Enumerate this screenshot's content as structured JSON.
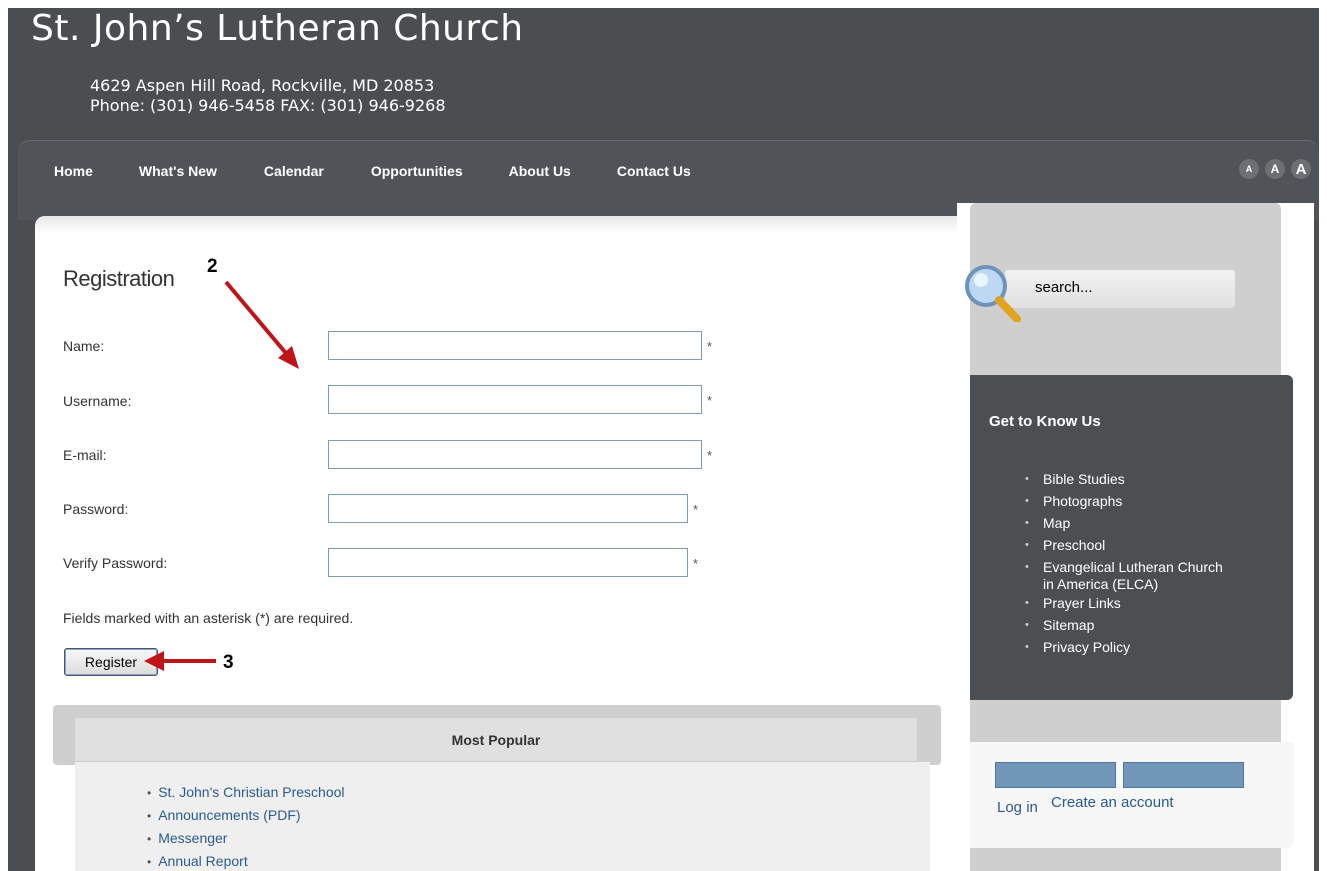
{
  "site": {
    "title": "St. John’s Lutheran Church",
    "address": "4629 Aspen Hill Road, Rockville, MD 20853",
    "phone": "Phone: (301) 946-5458 FAX: (301) 946-9268"
  },
  "nav": {
    "items": [
      "Home",
      "What's New",
      "Calendar",
      "Opportunities",
      "About Us",
      "Contact Us"
    ],
    "font_sizes": [
      "A",
      "A",
      "A"
    ]
  },
  "registration": {
    "title": "Registration",
    "fields": [
      {
        "label": "Name:",
        "value": "",
        "required_mark": "*"
      },
      {
        "label": "Username:",
        "value": "",
        "required_mark": "*"
      },
      {
        "label": "E-mail:",
        "value": "",
        "required_mark": "*"
      },
      {
        "label": "Password:",
        "value": "",
        "required_mark": "*"
      },
      {
        "label": "Verify Password:",
        "value": "",
        "required_mark": "*"
      }
    ],
    "note": "Fields marked with an asterisk (*) are required.",
    "button": "Register"
  },
  "annotations": {
    "step2": "2",
    "step3": "3",
    "arrow_color": "#c0141b"
  },
  "most_popular": {
    "title": "Most Popular",
    "items": [
      "St. John's Christian Preschool",
      "Announcements (PDF)",
      "Messenger",
      "Annual Report"
    ]
  },
  "sidebar": {
    "search_placeholder": "search...",
    "get_to_know": {
      "title": "Get to Know Us",
      "items": [
        "Bible Studies",
        "Photographs",
        "Map",
        "Preschool",
        "Evangelical Lutheran Church",
        "in America (ELCA)",
        "Prayer Links",
        "Sitemap",
        "Privacy Policy"
      ]
    },
    "login": {
      "log_in": "Log in",
      "create_account": "Create an account"
    }
  },
  "colors": {
    "header_bg": "#4a4e51",
    "link": "#2a5a94",
    "panel_dark": "#4b4f52"
  }
}
